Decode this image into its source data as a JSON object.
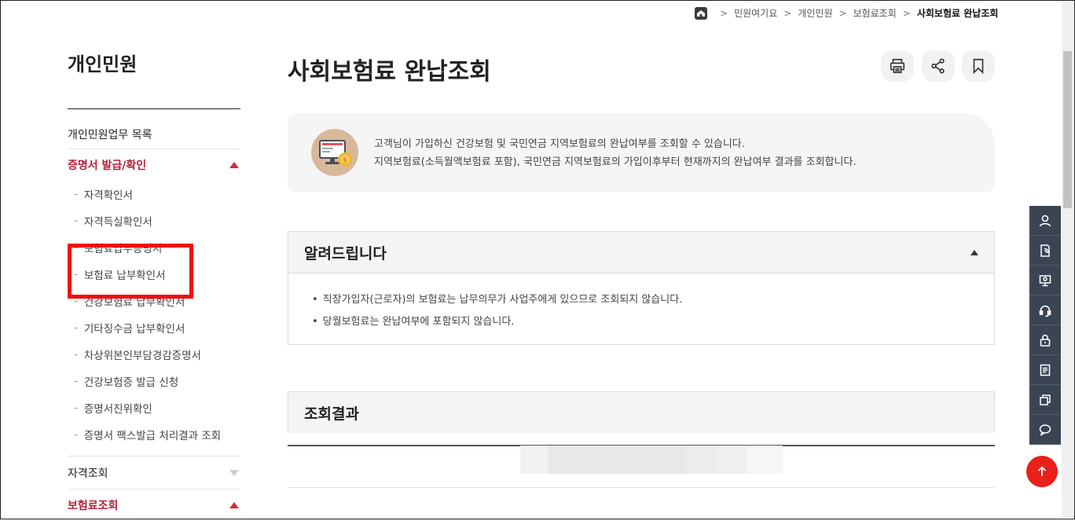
{
  "breadcrumb": {
    "items": [
      "민원여기요",
      "개인민원",
      "보험료조회"
    ],
    "current": "사회보험료 완납조회"
  },
  "sidebar": {
    "title": "개인민원",
    "menu": [
      {
        "label": "개인민원업무 목록"
      },
      {
        "label": "증명서 발급/확인",
        "expanded": true,
        "sub": [
          "자격확인서",
          "자격득실확인서",
          "보험료납부증명서",
          "보험료 납부확인서",
          "건강보험료 납부확인서",
          "기타징수금 납부확인서",
          "차상위본인부담경감증명서",
          "건강보험증 발급 신청",
          "증명서진위확인",
          "증명서 팩스발급 처리결과 조회"
        ]
      },
      {
        "label": "자격조회",
        "expanded": false
      },
      {
        "label": "보험료조회",
        "expanded": true
      }
    ]
  },
  "page": {
    "title": "사회보험료 완납조회",
    "tools": [
      "print-icon",
      "share-icon",
      "bookmark-icon"
    ]
  },
  "intro": {
    "line1": "고객님이 가입하신 건강보험 및 국민연금 지역보험료의 완납여부를 조회할 수 있습니다.",
    "line2": "지역보험료(소득월액보험료 포함), 국민연금 지역보험료의 가입이후부터 현재까지의 완납여부 결과를 조회합니다."
  },
  "notice": {
    "title": "알려드립니다",
    "items": [
      "직장가입자(근로자)의 보험료는 납무의무가 사업주에게 있으므로 조회되지 않습니다.",
      "당월보험료는 완납여부에 포함되지 않습니다."
    ]
  },
  "result": {
    "title": "조회결과"
  },
  "quickbar": [
    "user-icon",
    "document-phone-icon",
    "monitor-icon",
    "headset-icon",
    "lock-icon",
    "list-document-icon",
    "copy-icon",
    "chat-icon"
  ],
  "colors": {
    "accent": "#b5203a",
    "highlight": "#f20a0a",
    "quickbar": "#3a4453",
    "top_button": "#e8211a"
  }
}
